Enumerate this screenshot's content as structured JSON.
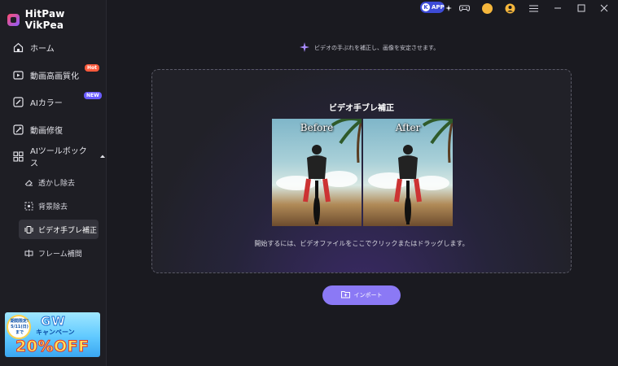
{
  "app": {
    "name": "HitPaw VikPea"
  },
  "sidebar": {
    "items": [
      {
        "label": "ホーム",
        "icon": "home-icon"
      },
      {
        "label": "動画高画質化",
        "icon": "video-enhance-icon",
        "badge": "Hot"
      },
      {
        "label": "AIカラー",
        "icon": "ai-color-icon",
        "badge": "NEW"
      },
      {
        "label": "動画修復",
        "icon": "repair-icon"
      },
      {
        "label": "AIツールボックス",
        "icon": "toolbox-icon"
      }
    ],
    "subitems": [
      {
        "label": "透かし除去",
        "icon": "eraser-icon"
      },
      {
        "label": "背景除去",
        "icon": "background-remove-icon"
      },
      {
        "label": "ビデオ手ブレ補正",
        "icon": "stabilize-icon"
      },
      {
        "label": "フレーム補間",
        "icon": "frame-interpolation-icon"
      }
    ],
    "promo": {
      "limited": "期間限定!",
      "date": "5/11(日)",
      "until": "まで",
      "gw": "GW",
      "campaign": "キャンペーン",
      "discount": "20%OFF"
    }
  },
  "titlebar": {
    "app_badge": "APP"
  },
  "main": {
    "hint": "ビデオの手ぶれを補正し、画像を安定させます。",
    "dropzone": {
      "title": "ビデオ手ブレ補正",
      "before_label": "Before",
      "after_label": "After",
      "subtitle": "開始するには、ビデオファイルをここでクリックまたはドラッグします。"
    },
    "import_label": "インポート"
  },
  "colors": {
    "accent": "#8b79f5",
    "hot": "#ff5a3c",
    "new": "#6a5cff"
  }
}
